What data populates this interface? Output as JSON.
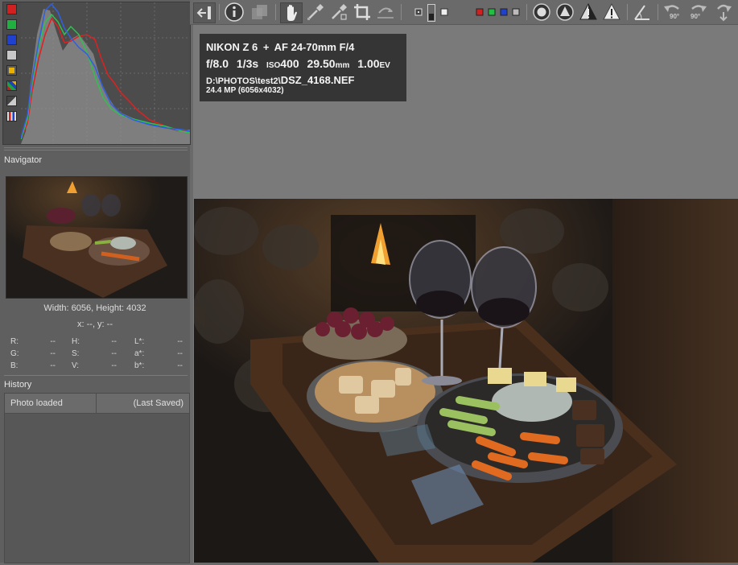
{
  "navigator": {
    "title": "Navigator",
    "size_text": "Width: 6056, Height: 4032",
    "coords_text": "x: --, y: --",
    "values": {
      "rgb": [
        {
          "k": "R:",
          "v": "--"
        },
        {
          "k": "G:",
          "v": "--"
        },
        {
          "k": "B:",
          "v": "--"
        }
      ],
      "hsv": [
        {
          "k": "H:",
          "v": "--"
        },
        {
          "k": "S:",
          "v": "--"
        },
        {
          "k": "V:",
          "v": "--"
        }
      ],
      "lab": [
        {
          "k": "L*:",
          "v": "--"
        },
        {
          "k": "a*:",
          "v": "--"
        },
        {
          "k": "b*:",
          "v": "--"
        }
      ]
    }
  },
  "history": {
    "title": "History",
    "rows": [
      {
        "action": "Photo loaded",
        "state": "(Last Saved)"
      }
    ]
  },
  "histogram": {
    "buttons": [
      {
        "name": "red-channel",
        "color": "#d02020"
      },
      {
        "name": "green-channel",
        "color": "#20b040"
      },
      {
        "name": "blue-channel",
        "color": "#2040d0"
      },
      {
        "name": "luminance",
        "color": "#c8c8c8"
      },
      {
        "name": "chroma",
        "color": "#e8b000"
      },
      {
        "name": "raw",
        "color": "#7a7a7a"
      },
      {
        "name": "bar",
        "color": "#a0a0a0"
      },
      {
        "name": "mode",
        "color": "#d0d0d0"
      }
    ]
  },
  "exif": {
    "camera": "NIKON Z 6",
    "lens": "AF 24-70mm F/4",
    "aperture": "f/8.0",
    "shutter": "1/3s",
    "iso_label": "ISO",
    "iso": "400",
    "focal": "29.50",
    "focal_unit": "mm",
    "ev": "1.00",
    "ev_unit": "EV",
    "path_prefix": "D:\\PHOTOS\\test2\\",
    "filename": "DSZ_4168.NEF",
    "megapixels": "24.4 MP (6056x4032)"
  },
  "toolbar": {
    "rotate_left": "90°",
    "rotate_right": "90°"
  },
  "colors": {
    "panel": "#5f5f5f",
    "preview_bg": "#7a7a7a",
    "info_bg": "#353535"
  }
}
